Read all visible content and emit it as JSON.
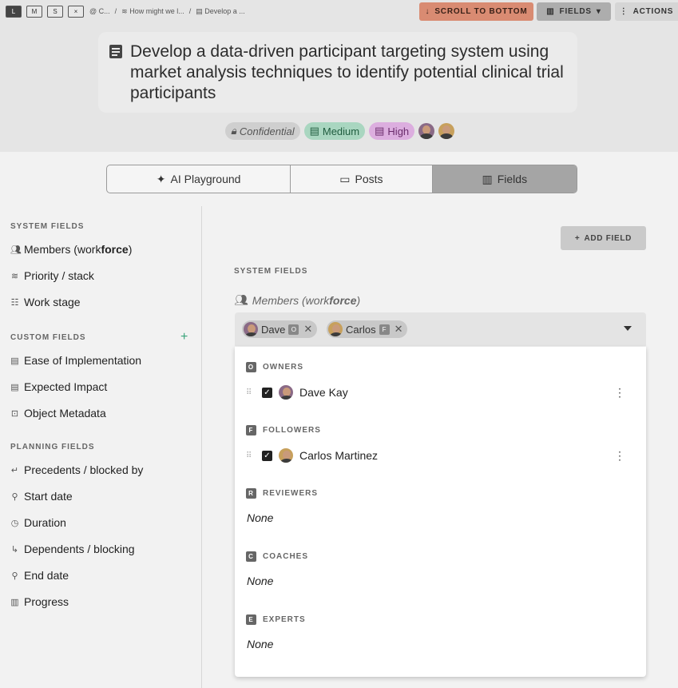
{
  "window_buttons": [
    "L",
    "M",
    "S",
    "×"
  ],
  "breadcrumb": {
    "workspace": "@ C...",
    "question": "How might we l...",
    "item": "Develop a ..."
  },
  "toolbar": {
    "scroll_label": "SCROLL TO BOTTOM",
    "fields_label": "FIELDS",
    "actions_label": "ACTIONS"
  },
  "title": "Develop a data-driven participant targeting system using market analysis techniques to identify potential clinical trial participants",
  "tags": {
    "confidential": "Confidential",
    "medium": "Medium",
    "high": "High"
  },
  "tabs": {
    "ai": "AI Playground",
    "posts": "Posts",
    "fields": "Fields"
  },
  "sidebar": {
    "system_title": "SYSTEM FIELDS",
    "members_pre": "Members (work",
    "members_bold": "force",
    "members_post": ")",
    "priority": "Priority / stack",
    "work_stage": "Work stage",
    "custom_title": "CUSTOM FIELDS",
    "ease": "Ease of Implementation",
    "impact": "Expected Impact",
    "metadata": "Object Metadata",
    "planning_title": "PLANNING FIELDS",
    "precedents": "Precedents / blocked by",
    "start": "Start date",
    "duration": "Duration",
    "dependents": "Dependents / blocking",
    "end": "End date",
    "progress": "Progress"
  },
  "main": {
    "add_field": "ADD FIELD",
    "system_title": "SYSTEM FIELDS",
    "members_pre": "Members (work",
    "members_bold": "force",
    "members_post": ")",
    "chips": [
      {
        "name": "Dave",
        "badge": "O"
      },
      {
        "name": "Carlos",
        "badge": "F"
      }
    ]
  },
  "dropdown": {
    "owners": {
      "badge": "O",
      "title": "OWNERS",
      "member": "Dave Kay"
    },
    "followers": {
      "badge": "F",
      "title": "FOLLOWERS",
      "member": "Carlos Martinez"
    },
    "reviewers": {
      "badge": "R",
      "title": "REVIEWERS",
      "empty": "None"
    },
    "coaches": {
      "badge": "C",
      "title": "COACHES",
      "empty": "None"
    },
    "experts": {
      "badge": "E",
      "title": "EXPERTS",
      "empty": "None"
    }
  }
}
